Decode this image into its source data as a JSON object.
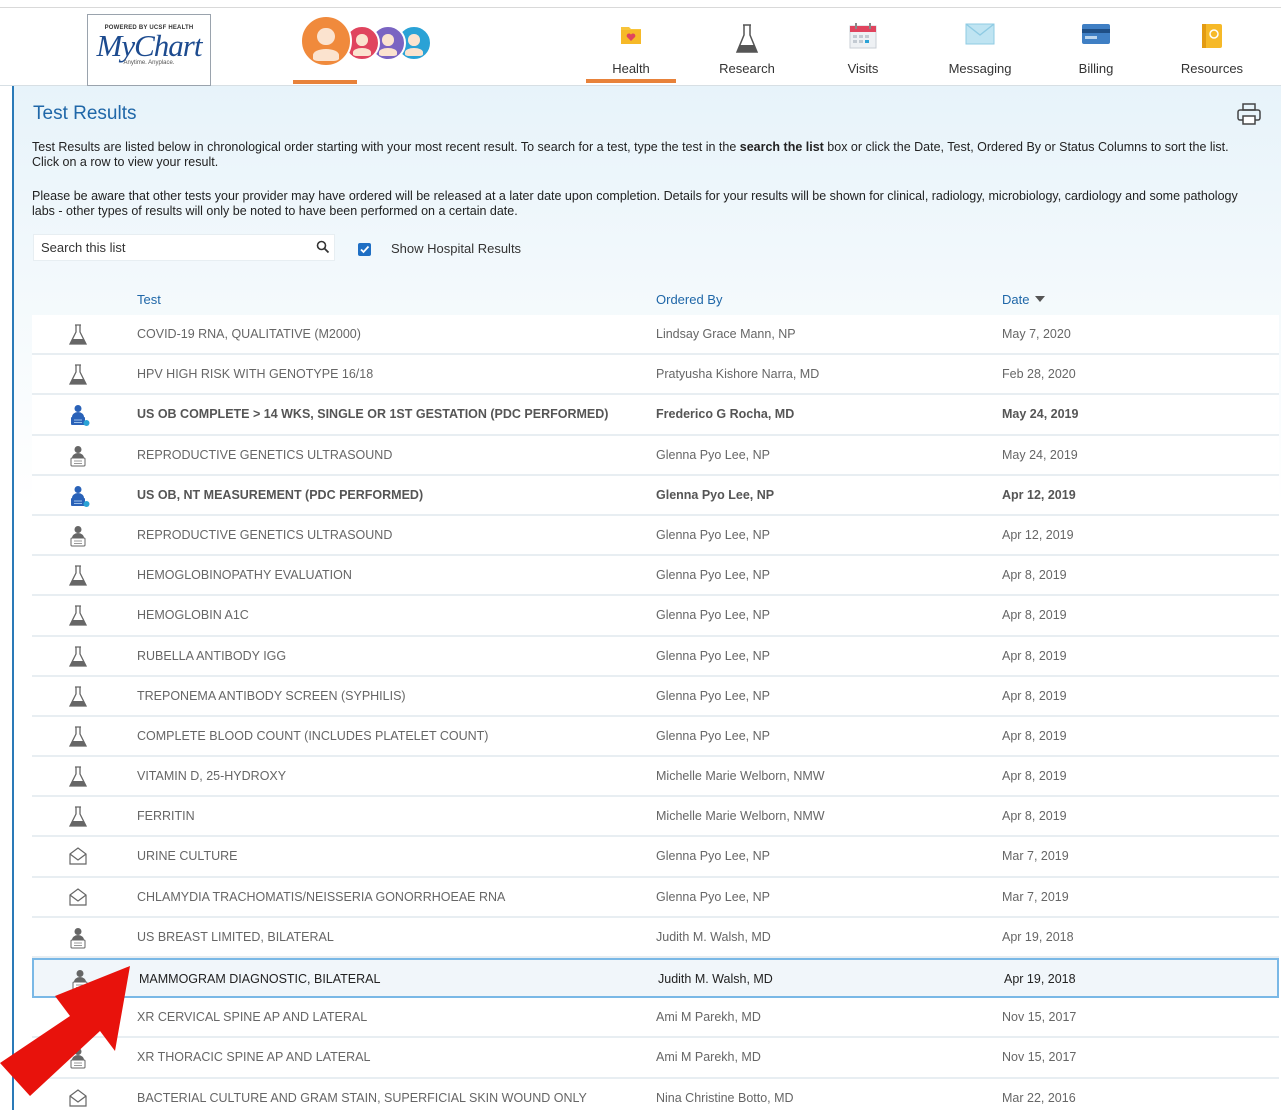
{
  "header": {
    "logo": {
      "powered_by": "POWERED BY UCSF HEALTH",
      "name": "MyChart",
      "tagline": "Anytime. Anyplace."
    },
    "nav": [
      {
        "label": "Health",
        "icon": "heart-folder-icon",
        "active": true
      },
      {
        "label": "Research",
        "icon": "flask-icon",
        "active": false
      },
      {
        "label": "Visits",
        "icon": "calendar-icon",
        "active": false
      },
      {
        "label": "Messaging",
        "icon": "envelope-icon",
        "active": false
      },
      {
        "label": "Billing",
        "icon": "credit-card-icon",
        "active": false
      },
      {
        "label": "Resources",
        "icon": "book-icon",
        "active": false
      }
    ]
  },
  "page": {
    "title": "Test Results",
    "intro_1_pre": "Test Results are listed below in chronological order starting with your most recent result. To search for a test, type the test in the ",
    "intro_1_bold": "search the list",
    "intro_1_post": " box or click the Date, Test, Ordered By or Status Columns to sort the list. Click on a row to view your result.",
    "intro_2": "Please be aware that other tests your provider may have ordered will be released at a later date upon completion. Details for your results will be shown for clinical, radiology, microbiology, cardiology and some pathology labs - other types of results will only be noted to have been performed on a certain date."
  },
  "search": {
    "placeholder": "Search this list",
    "show_hospital_label": "Show Hospital Results",
    "show_hospital_checked": true
  },
  "table": {
    "columns": {
      "test": "Test",
      "ordered_by": "Ordered By",
      "date": "Date"
    },
    "sort_column": "date",
    "rows": [
      {
        "icon": "lab",
        "test": "COVID-19 RNA, QUALITATIVE (M2000)",
        "ordered_by": "Lindsay Grace Mann, NP",
        "date": "May 7, 2020",
        "unread": false,
        "selected": false
      },
      {
        "icon": "lab",
        "test": "HPV HIGH RISK WITH GENOTYPE 16/18",
        "ordered_by": "Pratyusha Kishore Narra, MD",
        "date": "Feb 28, 2020",
        "unread": false,
        "selected": false
      },
      {
        "icon": "imaging-new",
        "test": "US OB COMPLETE > 14 WKS, SINGLE OR 1ST GESTATION (PDC PERFORMED)",
        "ordered_by": "Frederico G Rocha, MD",
        "date": "May 24, 2019",
        "unread": true,
        "selected": false
      },
      {
        "icon": "imaging",
        "test": "REPRODUCTIVE GENETICS ULTRASOUND",
        "ordered_by": "Glenna Pyo Lee, NP",
        "date": "May 24, 2019",
        "unread": false,
        "selected": false
      },
      {
        "icon": "imaging-new",
        "test": "US OB, NT MEASUREMENT (PDC PERFORMED)",
        "ordered_by": "Glenna Pyo Lee, NP",
        "date": "Apr 12, 2019",
        "unread": true,
        "selected": false
      },
      {
        "icon": "imaging",
        "test": "REPRODUCTIVE GENETICS ULTRASOUND",
        "ordered_by": "Glenna Pyo Lee, NP",
        "date": "Apr 12, 2019",
        "unread": false,
        "selected": false
      },
      {
        "icon": "lab",
        "test": "HEMOGLOBINOPATHY EVALUATION",
        "ordered_by": "Glenna Pyo Lee, NP",
        "date": "Apr 8, 2019",
        "unread": false,
        "selected": false
      },
      {
        "icon": "lab",
        "test": "HEMOGLOBIN A1C",
        "ordered_by": "Glenna Pyo Lee, NP",
        "date": "Apr 8, 2019",
        "unread": false,
        "selected": false
      },
      {
        "icon": "lab",
        "test": "RUBELLA ANTIBODY IGG",
        "ordered_by": "Glenna Pyo Lee, NP",
        "date": "Apr 8, 2019",
        "unread": false,
        "selected": false
      },
      {
        "icon": "lab",
        "test": "TREPONEMA ANTIBODY SCREEN (SYPHILIS)",
        "ordered_by": "Glenna Pyo Lee, NP",
        "date": "Apr 8, 2019",
        "unread": false,
        "selected": false
      },
      {
        "icon": "lab",
        "test": "COMPLETE BLOOD COUNT (INCLUDES PLATELET COUNT)",
        "ordered_by": "Glenna Pyo Lee, NP",
        "date": "Apr 8, 2019",
        "unread": false,
        "selected": false
      },
      {
        "icon": "lab",
        "test": "VITAMIN D, 25-HYDROXY",
        "ordered_by": "Michelle Marie Welborn, NMW",
        "date": "Apr 8, 2019",
        "unread": false,
        "selected": false
      },
      {
        "icon": "lab",
        "test": "FERRITIN",
        "ordered_by": "Michelle Marie Welborn, NMW",
        "date": "Apr 8, 2019",
        "unread": false,
        "selected": false
      },
      {
        "icon": "culture",
        "test": "URINE CULTURE",
        "ordered_by": "Glenna Pyo Lee, NP",
        "date": "Mar 7, 2019",
        "unread": false,
        "selected": false
      },
      {
        "icon": "culture",
        "test": "CHLAMYDIA TRACHOMATIS/NEISSERIA GONORRHOEAE RNA",
        "ordered_by": "Glenna Pyo Lee, NP",
        "date": "Mar 7, 2019",
        "unread": false,
        "selected": false
      },
      {
        "icon": "imaging",
        "test": "US BREAST LIMITED, BILATERAL",
        "ordered_by": "Judith M. Walsh, MD",
        "date": "Apr 19, 2018",
        "unread": false,
        "selected": false
      },
      {
        "icon": "imaging",
        "test": "MAMMOGRAM DIAGNOSTIC, BILATERAL",
        "ordered_by": "Judith M. Walsh, MD",
        "date": "Apr 19, 2018",
        "unread": false,
        "selected": true
      },
      {
        "icon": "imaging",
        "test": "XR CERVICAL SPINE AP AND LATERAL",
        "ordered_by": "Ami M Parekh, MD",
        "date": "Nov 15, 2017",
        "unread": false,
        "selected": false
      },
      {
        "icon": "imaging",
        "test": "XR THORACIC SPINE AP AND LATERAL",
        "ordered_by": "Ami M Parekh, MD",
        "date": "Nov 15, 2017",
        "unread": false,
        "selected": false
      },
      {
        "icon": "culture",
        "test": "BACTERIAL CULTURE AND GRAM STAIN, SUPERFICIAL SKIN WOUND ONLY",
        "ordered_by": "Nina Christine Botto, MD",
        "date": "Mar 22, 2016",
        "unread": false,
        "selected": false
      }
    ]
  },
  "annotation": {
    "icon": "red-arrow-icon",
    "color": "#e8120c"
  },
  "colors": {
    "accent": "#e8823a",
    "link": "#1f67a8",
    "selected_border": "#7ab8e6"
  }
}
